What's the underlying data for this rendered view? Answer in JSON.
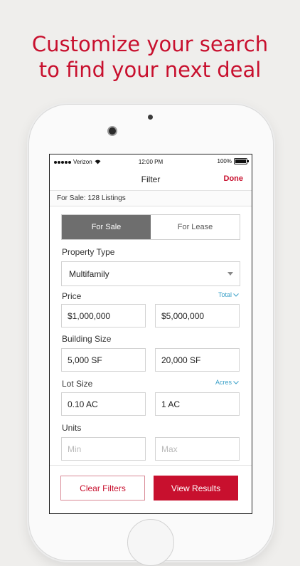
{
  "headline": {
    "line1": "Customize your search",
    "line2": "to find your next deal"
  },
  "status_bar": {
    "carrier": "Verizon",
    "time": "12:00 PM",
    "battery": "100%"
  },
  "nav": {
    "title": "Filter",
    "done_label": "Done"
  },
  "listing_summary": "For Sale: 128 Listings",
  "segmented": {
    "options": [
      "For Sale",
      "For Lease"
    ],
    "selected": "For Sale"
  },
  "property_type": {
    "label": "Property Type",
    "value": "Multifamily"
  },
  "price": {
    "label": "Price",
    "unit": "Total",
    "min": "$1,000,000",
    "max": "$5,000,000"
  },
  "building_size": {
    "label": "Building Size",
    "min": "5,000 SF",
    "max": "20,000 SF"
  },
  "lot_size": {
    "label": "Lot Size",
    "unit": "Acres",
    "min": "0.10 AC",
    "max": "1 AC"
  },
  "units": {
    "label": "Units",
    "min_placeholder": "Min",
    "max_placeholder": "Max"
  },
  "actions": {
    "clear_label": "Clear Filters",
    "view_label": "View Results"
  },
  "colors": {
    "accent": "#c8102e",
    "link": "#3aa0c8",
    "segment_active": "#6e6e6e"
  },
  "icons": [
    "wifi-icon",
    "battery-icon",
    "dropdown-caret-icon",
    "chevron-down-icon"
  ]
}
